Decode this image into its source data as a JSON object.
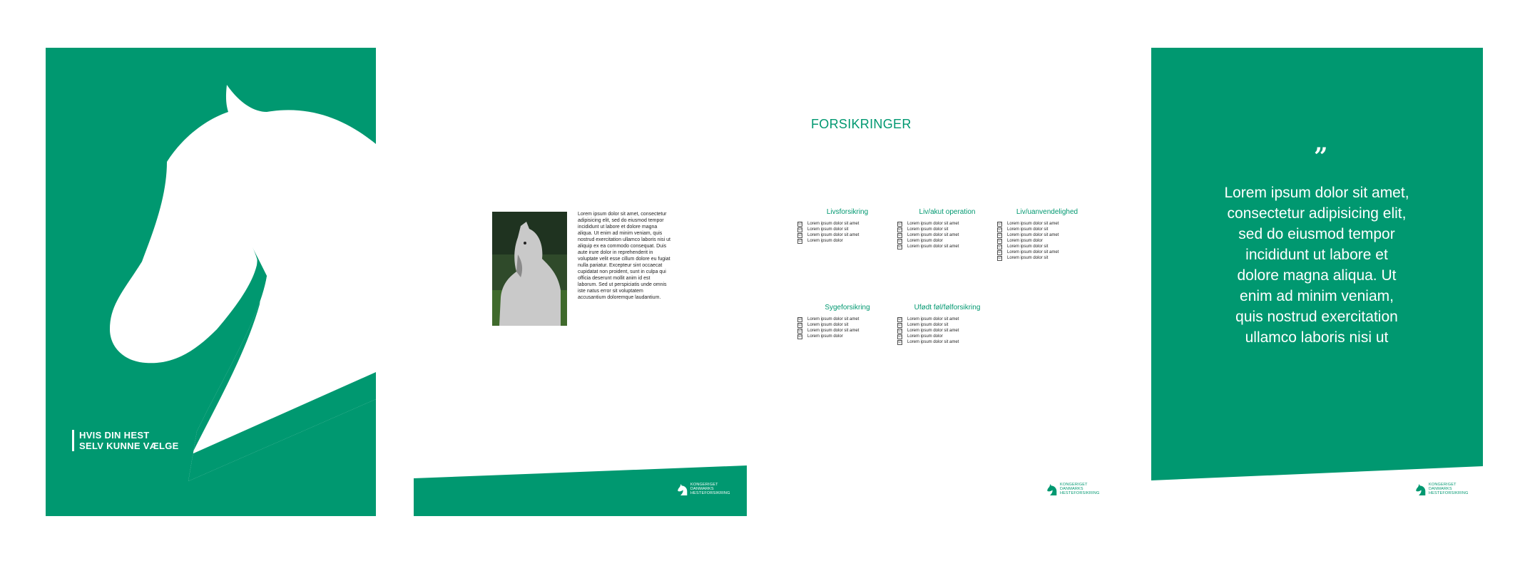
{
  "colors": {
    "brand_green": "#009870",
    "white": "#ffffff",
    "text": "#222222"
  },
  "cover": {
    "title_line1": "HVIS DIN HEST",
    "title_line2": "SELV KUNNE VÆLGE"
  },
  "page2": {
    "photo": "grey-horse-photo",
    "body": "Lorem ipsum dolor sit amet, consectetur adipisicing elit, sed do eiusmod tempor incididunt ut labore et dolore magna aliqua. Ut enim ad minim veniam, quis nostrud exercitation ullamco laboris nisi ut aliquip ex ea commodo consequat. Duis aute irure dolor in reprehenderit in voluptate velit esse cillum dolore eu fugiat nulla pariatur. Excepteur sint occaecat cupidatat non proident, sunt in culpa qui officia deserunt mollit anim id est laborum. Sed ut perspiciatis unde omnis iste natus error sit voluptatem accusantium doloremque laudantium."
  },
  "logo": {
    "line1": "KONGERIGET",
    "line2": "DANMARKS",
    "line3": "HESTEFORSIKRING"
  },
  "page3": {
    "heading": "FORSIKRINGER",
    "columns": [
      {
        "title": "Livsforsikring",
        "items": [
          "Lorem ipsum dolor sit amet",
          "Lorem ipsum dolor sit",
          "Lorem ipsum dolor sit amet",
          "Lorem ipsum dolor"
        ]
      },
      {
        "title": "Liv/akut operation",
        "items": [
          "Lorem ipsum dolor sit amet",
          "Lorem ipsum dolor sit",
          "Lorem ipsum dolor sit amet",
          "Lorem ipsum dolor",
          "Lorem ipsum dolor sit amet"
        ]
      },
      {
        "title": "Liv/uanvendelighed",
        "items": [
          "Lorem ipsum dolor sit amet",
          "Lorem ipsum dolor sit",
          "Lorem ipsum dolor sit amet",
          "Lorem ipsum dolor",
          "Lorem ipsum dolor sit",
          "Lorem ipsum dolor sit amet",
          "Lorem ipsum dolor sit"
        ]
      },
      {
        "title": "Sygeforsikring",
        "items": [
          "Lorem ipsum dolor sit amet",
          "Lorem ipsum dolor sit",
          "Lorem ipsum dolor sit amet",
          "Lorem ipsum dolor"
        ]
      },
      {
        "title": "Ufødt føl/følforsikring",
        "items": [
          "Lorem ipsum dolor sit amet",
          "Lorem ipsum dolor sit",
          "Lorem ipsum dolor sit amet",
          "Lorem ipsum dolor",
          "Lorem ipsum dolor sit amet"
        ]
      }
    ]
  },
  "page4": {
    "quote_mark": "”",
    "quote": "Lorem ipsum dolor sit amet, consectetur adipisicing elit, sed do eiusmod tempor incididunt ut labore et dolore magna aliqua. Ut enim ad minim veniam, quis nostrud exercitation ullamco laboris nisi ut"
  }
}
